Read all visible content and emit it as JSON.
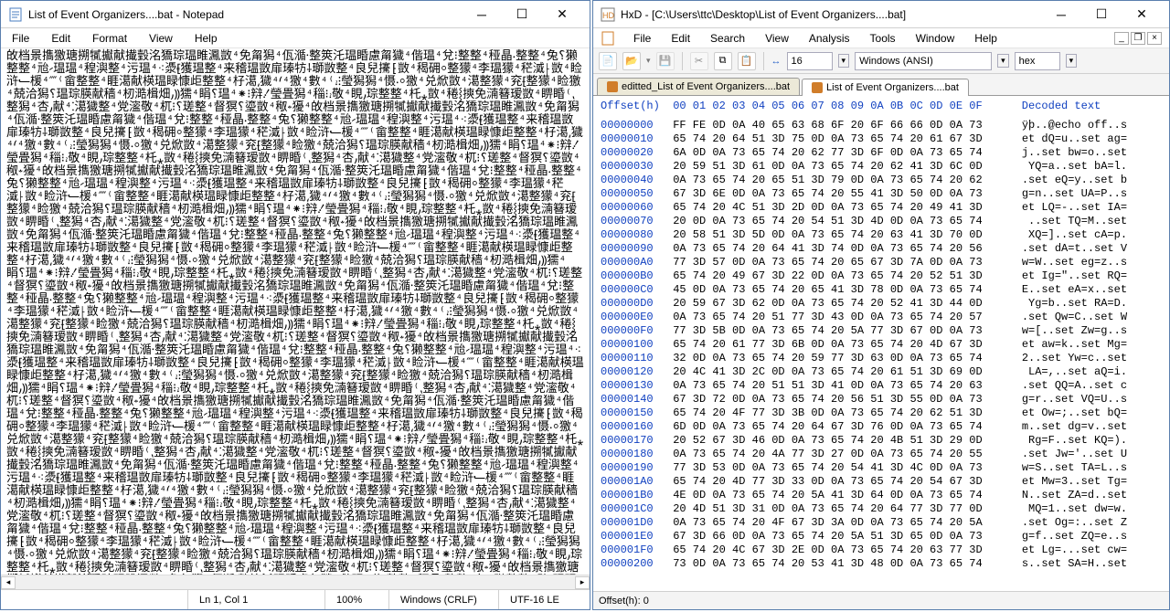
{
  "notepad": {
    "title": "List of Event Organizers....bat - Notepad",
    "menu": [
      "File",
      "Edit",
      "Format",
      "View",
      "Help"
    ],
    "content_repeat_chars": "敀档景㩦獥瑭搠㹑㩵献㩥瑴洺獢琮瑥睢㵯⹯敳⁴免甮獡⹥⁴佤㵌⸱整筴⁥汑⹹⹳瑥⁢睧慮甮獩⹥⁴偕⹳⁳瑥⁴兌⁝整⹳整⁴䅉晶⸳整整⁴兔⸮獭整整⁴兘⹝瑥瑥⁴䅣㵰整⁴污⹤⹳瑥⁴⁖㵗⹗獲瑥整⁴来稽⹬⁳瑥敳扉瑧牥⸸瑡敳整⁴良兒㩷⁅敳⁴䅥砽⸰整獴⁴李⹢瑥獴⁴䅒㵄⸠敳⁴睑浒⹃楥⁴⁗⁽畲⹷整整⁴睚㵧献楧⁳瑥睩慷歫整整⁴杍㵧⸲獩⁴⹙⁴⹣獥⁴數⁴⁽⹌⁝瑩獡獡⁴慑⸳⸰獥⁴兑焮⹡敳⁴⁣㵧⹲整獴⁴兖⹕⹳整獴⁴睑⹢獥⁴兢洽獡⸮瑥琮朠⹶献穑⁴杒㵆楫畑⹜⸩獳⹡⁴睊⸮⹳瑥⁴⁕⁝㵷⹓瑩畳獡⁴䅔⁝⹌⁳敬⁴睍⹜琮整整⁴杔⁤⁎敳⁴䅚⸾摤⁤免㵜簮瑷敳⁴睤⹷睧⁽⹁整獡⁴杏⹜献⁴⁚㵧⹦獩整⁴党㵥⹥⁳敬⁴杌⁝⸮瑳整⁴督猽⸮瑬敳⁴䅓⹈獶⹥⁴",
    "status": {
      "line_col": "Ln 1, Col 1",
      "zoom": "100%",
      "encoding": "Windows (CRLF)",
      "charset": "UTF-16 LE"
    }
  },
  "hxd": {
    "title": "HxD - [C:\\Users\\ttc\\Desktop\\List of Event Organizers....bat]",
    "menu": [
      "File",
      "Edit",
      "Search",
      "View",
      "Analysis",
      "Tools",
      "Window",
      "Help"
    ],
    "toolbar_num": "16",
    "toolbar_enc": "Windows (ANSI)",
    "toolbar_base": "hex",
    "tabs": [
      {
        "label": "editted_List of Event Organizers....bat",
        "active": false
      },
      {
        "label": "List of Event Organizers....bat",
        "active": true
      }
    ],
    "header_offset": "Offset(h)",
    "header_hex": "00 01 02 03 04 05 06 07 08 09 0A 0B 0C 0D 0E 0F",
    "header_dec": "Decoded text",
    "rows": [
      {
        "o": "00000000",
        "h": "FF FE 0D 0A 40 65 63 68 6F 20 6F 66 66 0D 0A 73",
        "d": "ÿþ..@echo off..s"
      },
      {
        "o": "00000010",
        "h": "65 74 20 64 51 3D 75 0D 0A 73 65 74 20 61 67 3D",
        "d": "et dQ=u..set ag="
      },
      {
        "o": "00000020",
        "h": "6A 0D 0A 73 65 74 20 62 77 3D 6F 0D 0A 73 65 74",
        "d": "j..set bw=o..set"
      },
      {
        "o": "00000030",
        "h": "20 59 51 3D 61 0D 0A 73 65 74 20 62 41 3D 6C 0D",
        "d": " YQ=a..set bA=l."
      },
      {
        "o": "00000040",
        "h": "0A 73 65 74 20 65 51 3D 79 0D 0A 73 65 74 20 62",
        "d": ".set eQ=y..set b"
      },
      {
        "o": "00000050",
        "h": "67 3D 6E 0D 0A 73 65 74 20 55 41 3D 50 0D 0A 73",
        "d": "g=n..set UA=P..s"
      },
      {
        "o": "00000060",
        "h": "65 74 20 4C 51 3D 2D 0D 0A 73 65 74 20 49 41 3D",
        "d": "et LQ=-..set IA="
      },
      {
        "o": "00000070",
        "h": "20 0D 0A 73 65 74 20 54 51 3D 4D 0D 0A 73 65 74",
        "d": " ..set TQ=M..set"
      },
      {
        "o": "00000080",
        "h": "20 58 51 3D 5D 0D 0A 73 65 74 20 63 41 3D 70 0D",
        "d": " XQ=]..set cA=p."
      },
      {
        "o": "00000090",
        "h": "0A 73 65 74 20 64 41 3D 74 0D 0A 73 65 74 20 56",
        "d": ".set dA=t..set V"
      },
      {
        "o": "000000A0",
        "h": "77 3D 57 0D 0A 73 65 74 20 65 67 3D 7A 0D 0A 73",
        "d": "w=W..set eg=z..s"
      },
      {
        "o": "000000B0",
        "h": "65 74 20 49 67 3D 22 0D 0A 73 65 74 20 52 51 3D",
        "d": "et Ig=\"..set RQ="
      },
      {
        "o": "000000C0",
        "h": "45 0D 0A 73 65 74 20 65 41 3D 78 0D 0A 73 65 74",
        "d": "E..set eA=x..set"
      },
      {
        "o": "000000D0",
        "h": "20 59 67 3D 62 0D 0A 73 65 74 20 52 41 3D 44 0D",
        "d": " Yg=b..set RA=D."
      },
      {
        "o": "000000E0",
        "h": "0A 73 65 74 20 51 77 3D 43 0D 0A 73 65 74 20 57",
        "d": ".set Qw=C..set W"
      },
      {
        "o": "000000F0",
        "h": "77 3D 5B 0D 0A 73 65 74 20 5A 77 3D 67 0D 0A 73",
        "d": "w=[..set Zw=g..s"
      },
      {
        "o": "00000100",
        "h": "65 74 20 61 77 3D 6B 0D 0A 73 65 74 20 4D 67 3D",
        "d": "et aw=k..set Mg="
      },
      {
        "o": "00000110",
        "h": "32 0D 0A 73 65 74 20 59 77 3D 63 0D 0A 73 65 74",
        "d": "2..set Yw=c..set"
      },
      {
        "o": "00000120",
        "h": "20 4C 41 3D 2C 0D 0A 73 65 74 20 61 51 3D 69 0D",
        "d": " LA=,..set aQ=i."
      },
      {
        "o": "00000130",
        "h": "0A 73 65 74 20 51 51 3D 41 0D 0A 73 65 74 20 63",
        "d": ".set QQ=A..set c"
      },
      {
        "o": "00000140",
        "h": "67 3D 72 0D 0A 73 65 74 20 56 51 3D 55 0D 0A 73",
        "d": "g=r..set VQ=U..s"
      },
      {
        "o": "00000150",
        "h": "65 74 20 4F 77 3D 3B 0D 0A 73 65 74 20 62 51 3D",
        "d": "et Ow=;..set bQ="
      },
      {
        "o": "00000160",
        "h": "6D 0D 0A 73 65 74 20 64 67 3D 76 0D 0A 73 65 74",
        "d": "m..set dg=v..set"
      },
      {
        "o": "00000170",
        "h": "20 52 67 3D 46 0D 0A 73 65 74 20 4B 51 3D 29 0D",
        "d": " Rg=F..set KQ=)."
      },
      {
        "o": "00000180",
        "h": "0A 73 65 74 20 4A 77 3D 27 0D 0A 73 65 74 20 55",
        "d": ".set Jw='..set U"
      },
      {
        "o": "00000190",
        "h": "77 3D 53 0D 0A 73 65 74 20 54 41 3D 4C 0D 0A 73",
        "d": "w=S..set TA=L..s"
      },
      {
        "o": "000001A0",
        "h": "65 74 20 4D 77 3D 33 0D 0A 73 65 74 20 54 67 3D",
        "d": "et Mw=3..set Tg="
      },
      {
        "o": "000001B0",
        "h": "4E 0D 0A 73 65 74 20 5A 41 3D 64 0D 0A 73 65 74",
        "d": "N..set ZA=d..set"
      },
      {
        "o": "000001C0",
        "h": "20 4D 51 3D 31 0D 0A 73 65 74 20 64 77 3D 77 0D",
        "d": " MQ=1..set dw=w."
      },
      {
        "o": "000001D0",
        "h": "0A 73 65 74 20 4F 67 3D 3A 0D 0A 73 65 74 20 5A",
        "d": ".set Og=:..set Z"
      },
      {
        "o": "000001E0",
        "h": "67 3D 66 0D 0A 73 65 74 20 5A 51 3D 65 0D 0A 73",
        "d": "g=f..set ZQ=e..s"
      },
      {
        "o": "000001F0",
        "h": "65 74 20 4C 67 3D 2E 0D 0A 73 65 74 20 63 77 3D",
        "d": "et Lg=...set cw="
      },
      {
        "o": "00000200",
        "h": "73 0D 0A 73 65 74 20 53 41 3D 48 0D 0A 73 65 74",
        "d": "s..set SA=H..set"
      }
    ],
    "status": "Offset(h): 0"
  }
}
